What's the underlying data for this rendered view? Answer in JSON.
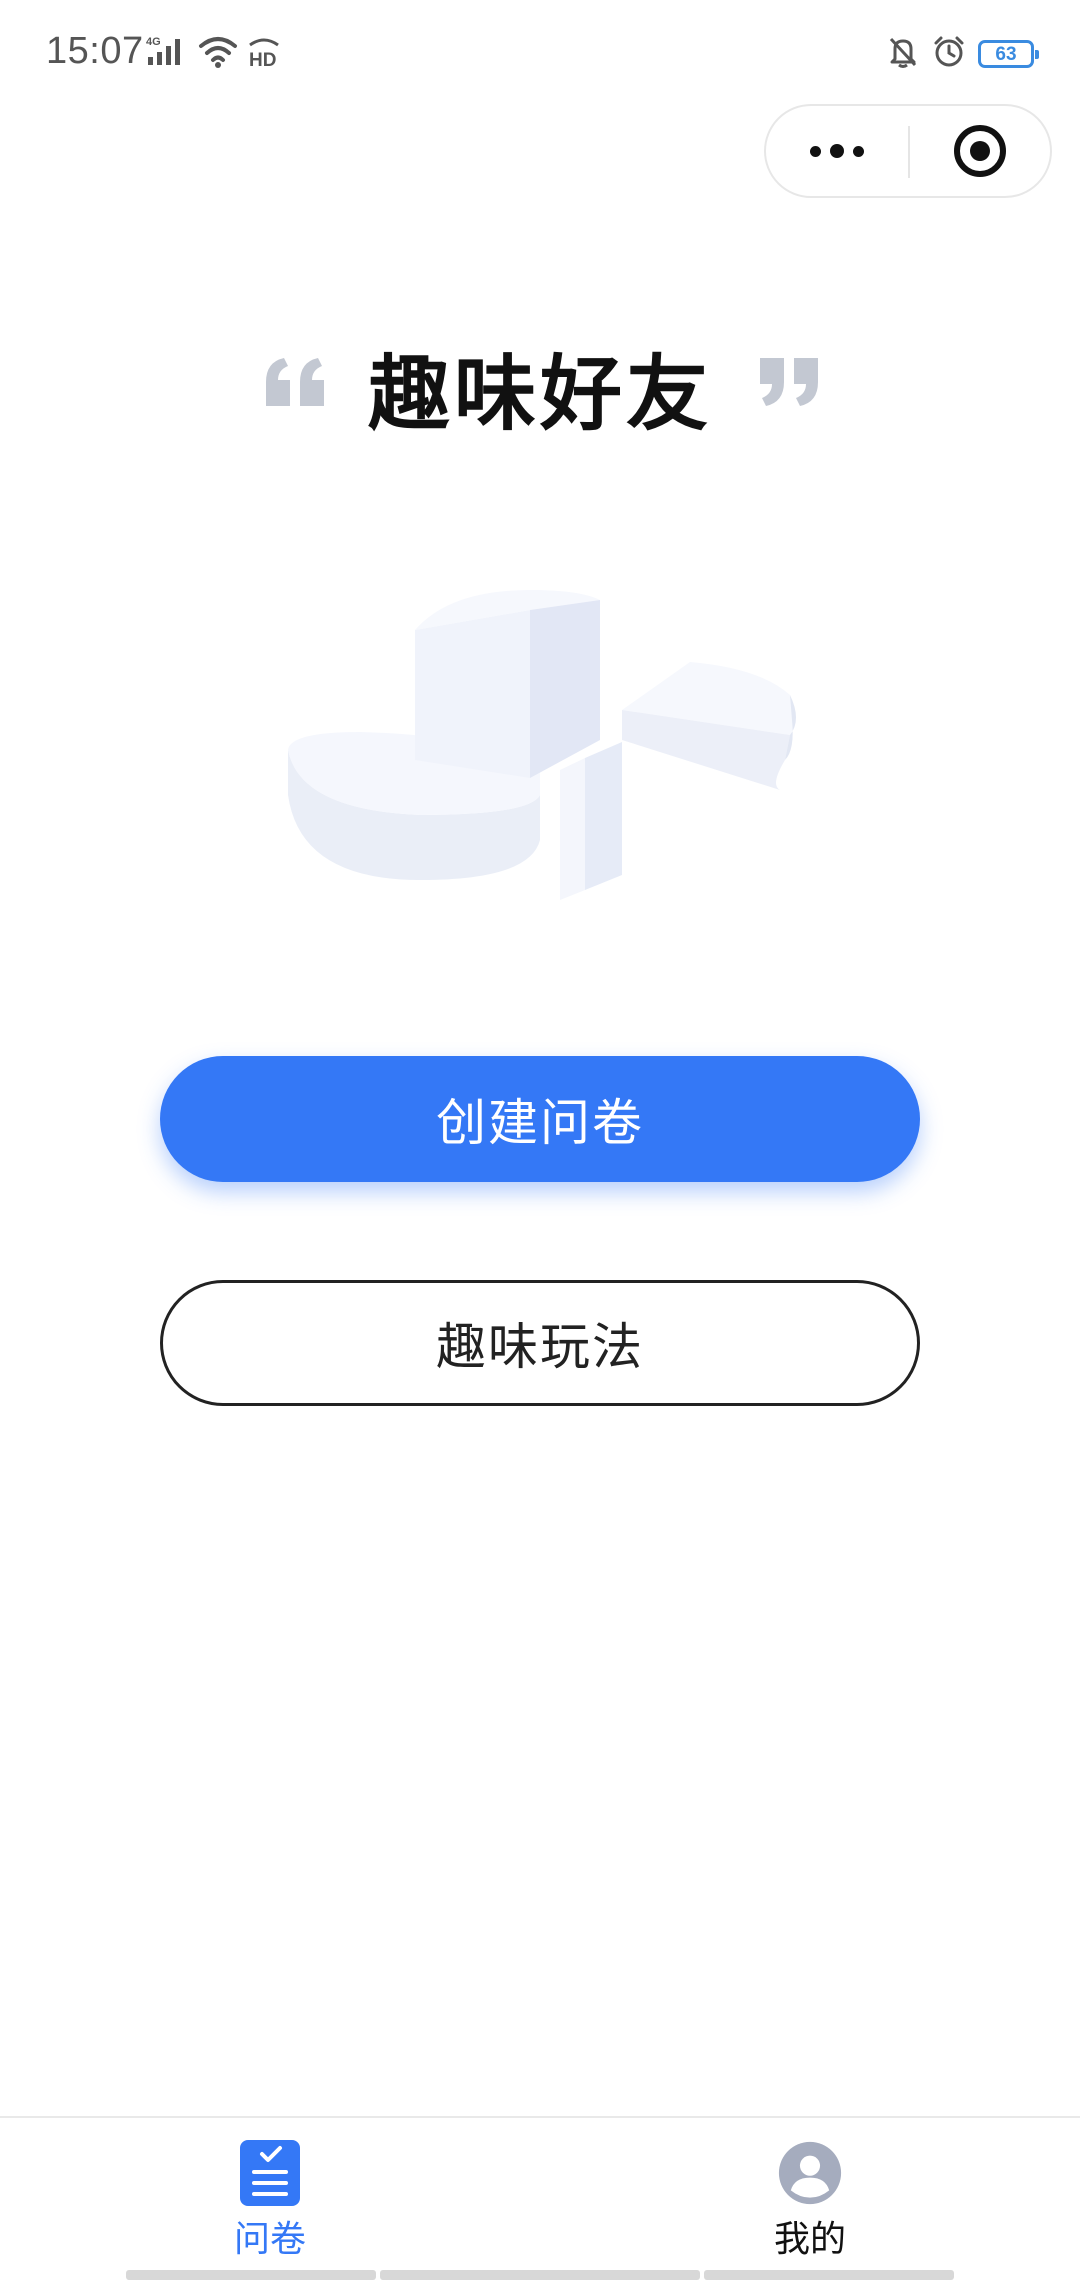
{
  "status_bar": {
    "time": "15:07",
    "network_label": "4G",
    "hd_label": "HD",
    "battery_level": "63",
    "icons": [
      "signal-icon",
      "wifi-icon",
      "hd-icon",
      "mute-bell-icon",
      "alarm-icon",
      "battery-icon"
    ]
  },
  "capsule": {
    "more_icon": "more-dots-icon",
    "close_icon": "target-circle-icon"
  },
  "header": {
    "title": "趣味好友",
    "quote_icons": [
      "open-quote-icon",
      "close-quote-icon"
    ]
  },
  "illustration": {
    "icon": "empty-state-3d-illustration"
  },
  "actions": {
    "create_label": "创建问卷",
    "fun_label": "趣味玩法"
  },
  "tab_bar": {
    "tabs": [
      {
        "label": "问卷",
        "icon": "survey-checklist-icon",
        "active": true
      },
      {
        "label": "我的",
        "icon": "user-avatar-icon",
        "active": false
      }
    ]
  },
  "colors": {
    "accent": "#3478f6",
    "title": "#111111",
    "quote": "#c3c8d2",
    "illustration": "#eef2fa",
    "tab_inactive": "#111111"
  }
}
